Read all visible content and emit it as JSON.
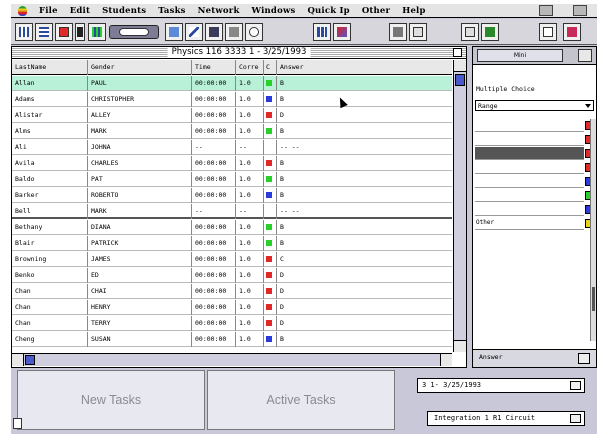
{
  "menu": {
    "items": [
      "File",
      "Edit",
      "Students",
      "Tasks",
      "Network",
      "Windows",
      "Quick Ip",
      "Other",
      "Help"
    ]
  },
  "toolbar": {
    "icons": [
      "grid-icon",
      "table-icon",
      "list-icon",
      "up-down-icon",
      "table-icon",
      "insert-icon",
      "student-icon",
      "checkmark-icon",
      "filter-icon",
      "camera-icon",
      "clock-icon",
      "chart-icon",
      "tools-icon",
      "calculator-icon",
      "window-icon",
      "window-icon",
      "network-icon",
      "layout-icon"
    ]
  },
  "main_window": {
    "title": "Physics 116 3333   1 - 3/25/1993"
  },
  "table": {
    "headers": [
      "LastName",
      "Gender",
      "Time",
      "Corre",
      "C",
      "Answer"
    ],
    "rows": [
      {
        "last": "Allan",
        "gender": "PAUL",
        "time": "00:00:00",
        "corr": "1.0",
        "color": "#2ad02a",
        "answer": "B",
        "selected": true
      },
      {
        "last": "Adams",
        "gender": "CHRISTOPHER",
        "time": "00:00:00",
        "corr": "1.0",
        "color": "#2a3adc",
        "answer": "B"
      },
      {
        "last": "Alistar",
        "gender": "ALLEY",
        "time": "00:00:00",
        "corr": "1.0",
        "color": "#e02a2a",
        "answer": "D"
      },
      {
        "last": "Alms",
        "gender": "MARK",
        "time": "00:00:00",
        "corr": "1.0",
        "color": "#2ad02a",
        "answer": "B"
      },
      {
        "last": "Ali",
        "gender": "JOHNA",
        "time": "--",
        "corr": "--",
        "color": "",
        "answer": "-- --"
      },
      {
        "last": "Avila",
        "gender": "CHARLES",
        "time": "00:00:00",
        "corr": "1.0",
        "color": "#e02a2a",
        "answer": "B"
      },
      {
        "last": "Baldo",
        "gender": "PAT",
        "time": "00:00:00",
        "corr": "1.0",
        "color": "#2ad02a",
        "answer": "B"
      },
      {
        "last": "Barker",
        "gender": "ROBERTO",
        "time": "00:00:00",
        "corr": "1.0",
        "color": "#2a3adc",
        "answer": "B"
      },
      {
        "last": "Bell",
        "gender": "MARK",
        "time": "--",
        "corr": "--",
        "color": "",
        "answer": "-- --",
        "divider": true
      },
      {
        "last": "Bethany",
        "gender": "DIANA",
        "time": "00:00:00",
        "corr": "1.0",
        "color": "#2ad02a",
        "answer": "B"
      },
      {
        "last": "Blair",
        "gender": "PATRICK",
        "time": "00:00:00",
        "corr": "1.0",
        "color": "#2ad02a",
        "answer": "B"
      },
      {
        "last": "Browning",
        "gender": "JAMES",
        "time": "00:00:00",
        "corr": "1.0",
        "color": "#e02a2a",
        "answer": "C"
      },
      {
        "last": "Benko",
        "gender": "ED",
        "time": "00:00:00",
        "corr": "1.0",
        "color": "#e02a2a",
        "answer": "D"
      },
      {
        "last": "Chan",
        "gender": "CHAI",
        "time": "00:00:00",
        "corr": "1.0",
        "color": "#e02a2a",
        "answer": "D"
      },
      {
        "last": "Chan",
        "gender": "HENRY",
        "time": "00:00:00",
        "corr": "1.0",
        "color": "#e02a2a",
        "answer": "D"
      },
      {
        "last": "Chan",
        "gender": "TERRY",
        "time": "00:00:00",
        "corr": "1.0",
        "color": "#e02a2a",
        "answer": "D"
      },
      {
        "last": "Cheng",
        "gender": "SUSAN",
        "time": "00:00:00",
        "corr": "1.0",
        "color": "#2a3adc",
        "answer": "B"
      }
    ]
  },
  "side_panel": {
    "tab_label": "Mini",
    "question_type": "Multiple Choice",
    "range_select": "Range",
    "choices": [
      {
        "label": "",
        "color": "#e02a2a"
      },
      {
        "label": "",
        "color": "#e02a2a"
      },
      {
        "label": "",
        "color": "#e02a2a",
        "dark": true
      },
      {
        "label": "",
        "color": "#e02a2a"
      },
      {
        "label": "",
        "color": "#2a3adc"
      },
      {
        "label": "",
        "color": "#2ad02a"
      },
      {
        "label": "",
        "color": "#2a3adc"
      },
      {
        "label": "Other",
        "color": "#e6d21a"
      }
    ],
    "answer_label": "Answer"
  },
  "bottom": {
    "new_tasks": "New Tasks",
    "active_tasks": "Active Tasks",
    "session": "3 1- 3/25/1993",
    "program": "Integration 1 R1 Circuit"
  }
}
